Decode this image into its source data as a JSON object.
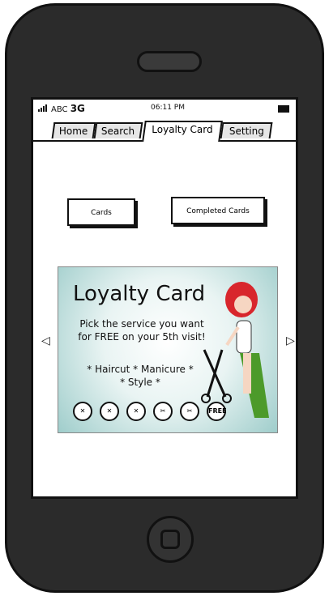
{
  "status_bar": {
    "carrier": "ABC",
    "network": "3G",
    "time": "06:11 PM"
  },
  "tabs": [
    {
      "label": "Home"
    },
    {
      "label": "Search"
    },
    {
      "label": "Loyalty Card",
      "active": true
    },
    {
      "label": "Setting"
    }
  ],
  "buttons": {
    "cards": "Cards",
    "completed_cards": "Completed Cards"
  },
  "nav": {
    "prev": "◁",
    "next": "▷"
  },
  "card": {
    "title": "Loyalty Card",
    "subtitle": "Pick the service you want for FREE on your 5th visit!",
    "services_line1": "* Haircut * Manicure *",
    "services_line2": "* Style *",
    "free_label": "FREE",
    "accent_color": "#9fcdcb",
    "stamps": [
      "used",
      "used",
      "used",
      "scissors",
      "scissors",
      "free"
    ]
  }
}
